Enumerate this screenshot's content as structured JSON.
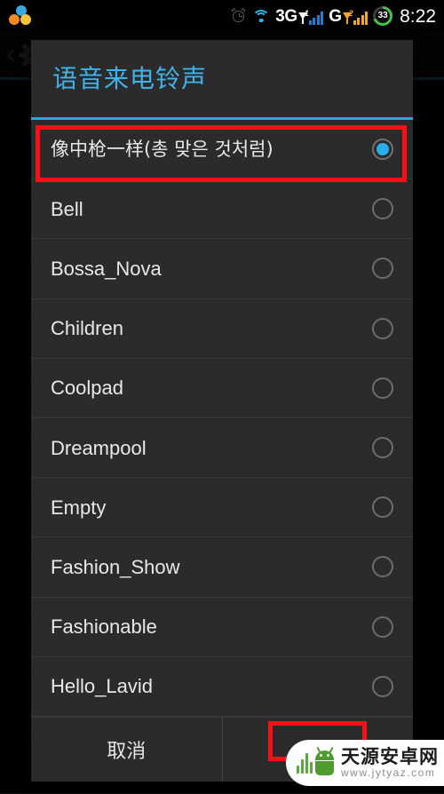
{
  "status_bar": {
    "notification_logo": "tri-circle-logo",
    "alarm_icon": "alarm-clock-icon",
    "wifi_icon": "wifi-icon",
    "sim1_label": "3G",
    "sim1_antenna_sup": "1",
    "sim2_label": "G",
    "sim2_antenna_sup": "2",
    "battery_percent": "33",
    "time": "8:22"
  },
  "background": {
    "back_icon": "back-chevron-icon",
    "gear_icon": "gear-icon",
    "rows": [
      {
        "title": "",
        "sub": ""
      },
      {
        "title": "",
        "sub": ""
      },
      {
        "title": "",
        "sub": ""
      },
      {
        "title": "",
        "sub": ""
      },
      {
        "title": "",
        "sub": ""
      },
      {
        "title": "",
        "sub": ""
      },
      {
        "title": "",
        "sub": ""
      },
      {
        "title": "",
        "sub": ""
      },
      {
        "title": "",
        "sub": ""
      },
      {
        "title": "",
        "sub": ""
      },
      {
        "title": "",
        "sub": ""
      },
      {
        "title": "",
        "sub": ""
      }
    ]
  },
  "dialog": {
    "title": "语音来电铃声",
    "title_color": "#3fb3ea",
    "accent_color": "#2da5e0",
    "selected_radio_color": "#29b0ec",
    "items": [
      {
        "label": "像中枪一样(총 맞은 것처럼)",
        "selected": true,
        "cjk": true
      },
      {
        "label": "Bell",
        "selected": false,
        "cjk": false
      },
      {
        "label": "Bossa_Nova",
        "selected": false,
        "cjk": false
      },
      {
        "label": "Children",
        "selected": false,
        "cjk": false
      },
      {
        "label": "Coolpad",
        "selected": false,
        "cjk": false
      },
      {
        "label": "Dreampool",
        "selected": false,
        "cjk": false
      },
      {
        "label": "Empty",
        "selected": false,
        "cjk": false
      },
      {
        "label": "Fashion_Show",
        "selected": false,
        "cjk": false
      },
      {
        "label": "Fashionable",
        "selected": false,
        "cjk": false
      },
      {
        "label": "Hello_Lavid",
        "selected": false,
        "cjk": false
      }
    ],
    "cancel_label": "取消",
    "ok_label": ""
  },
  "annotations": {
    "highlight_color": "#fa0f19",
    "boxes": [
      {
        "name": "selected-item-highlight"
      },
      {
        "name": "ok-button-highlight"
      }
    ]
  },
  "watermark": {
    "site_name": "天源安卓网",
    "url": "www.jytyaz.com",
    "logo": "android-robot-icon"
  }
}
